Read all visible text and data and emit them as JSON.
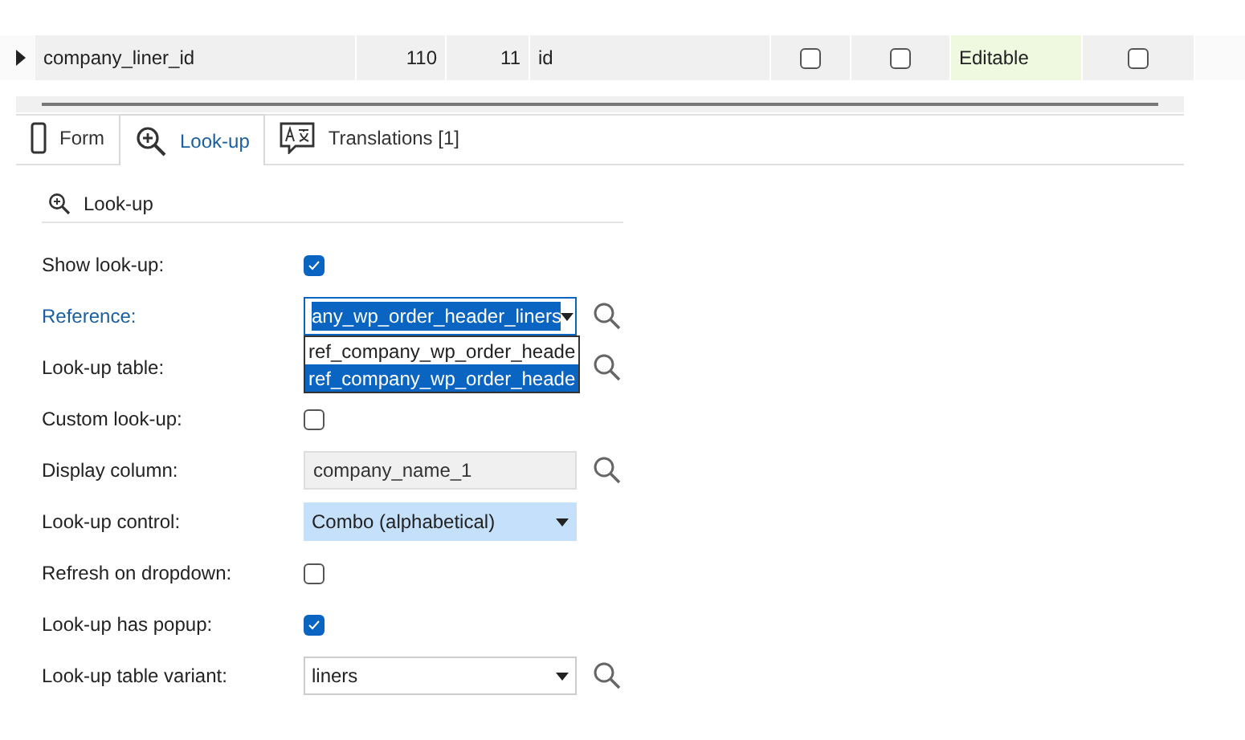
{
  "grid": {
    "row": [
      {
        "kind": "text",
        "value": "company_liner_id"
      },
      {
        "kind": "number",
        "value": "110"
      },
      {
        "kind": "number",
        "value": "11"
      },
      {
        "kind": "text",
        "value": "id"
      },
      {
        "kind": "checkbox",
        "checked": false
      },
      {
        "kind": "checkbox",
        "checked": false
      },
      {
        "kind": "tag",
        "value": "Editable"
      },
      {
        "kind": "checkbox",
        "checked": false
      }
    ]
  },
  "tabs": [
    {
      "label": "Form",
      "selected": false
    },
    {
      "label": "Look-up",
      "selected": true
    },
    {
      "label": "Translations [1]",
      "selected": false
    }
  ],
  "section": {
    "title": "Look-up"
  },
  "fields": [
    {
      "label": "Show look-up:",
      "kind": "checkbox",
      "checked": true
    },
    {
      "label": "Reference:",
      "kind": "select",
      "value": "any_wp_order_header_liners",
      "focused": true,
      "search": true,
      "dropdown": [
        {
          "label": "ref_company_wp_order_heade",
          "selected": false
        },
        {
          "label": "ref_company_wp_order_heade",
          "selected": true
        }
      ]
    },
    {
      "label": "Look-up table:",
      "kind": "covered",
      "search": true
    },
    {
      "label": "Custom look-up:",
      "kind": "checkbox",
      "checked": false
    },
    {
      "label": "Display column:",
      "kind": "readonly",
      "value": "company_name_1",
      "search": true
    },
    {
      "label": "Look-up control:",
      "kind": "combo",
      "value": "Combo (alphabetical)"
    },
    {
      "label": "Refresh on dropdown:",
      "kind": "checkbox",
      "checked": false
    },
    {
      "label": "Look-up has popup:",
      "kind": "checkbox",
      "checked": true
    },
    {
      "label": "Look-up table variant:",
      "kind": "select",
      "value": "liners",
      "focused": false,
      "search": true
    }
  ]
}
